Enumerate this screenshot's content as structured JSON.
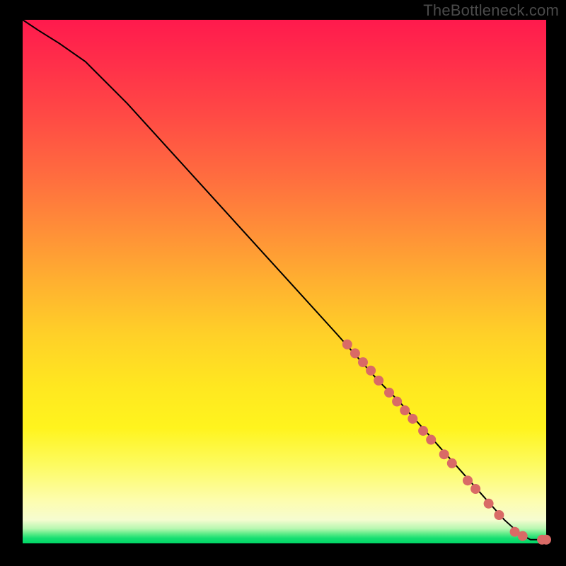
{
  "watermark": "TheBottleneck.com",
  "colors": {
    "dot": "#d96a66",
    "curve": "#000000",
    "bg": "#000000"
  },
  "chart_data": {
    "type": "line",
    "title": "",
    "xlabel": "",
    "ylabel": "",
    "xlim": [
      0,
      100
    ],
    "ylim": [
      0,
      100
    ],
    "grid": false,
    "note": "Axes are unlabeled in the source image; values are inferred on a 0–100 normalized scale where (0,0) is bottom-left.",
    "series": [
      {
        "name": "curve",
        "kind": "line",
        "x": [
          0,
          3,
          7,
          12,
          20,
          30,
          40,
          50,
          60,
          68,
          72,
          76,
          80,
          84,
          88,
          92,
          95,
          97,
          100
        ],
        "y": [
          100,
          98,
          95.5,
          92,
          84,
          73,
          62,
          51,
          40,
          31,
          27,
          22.5,
          18,
          13.5,
          9,
          4.5,
          1.8,
          0.7,
          0.7
        ]
      },
      {
        "name": "highlighted-points",
        "kind": "scatter",
        "x": [
          62,
          63.5,
          65,
          66.5,
          68,
          70,
          71.5,
          73,
          74.5,
          76.5,
          78,
          80.5,
          82,
          85,
          86.5,
          89,
          91,
          94,
          95.5,
          99.2,
          100
        ],
        "y": [
          38,
          36.3,
          34.6,
          33,
          31.1,
          28.8,
          27.1,
          25.4,
          23.8,
          21.5,
          19.8,
          17,
          15.3,
          12,
          10.4,
          7.6,
          5.4,
          2.2,
          1.4,
          0.7,
          0.7
        ],
        "marker_radius_px": 7
      }
    ]
  }
}
